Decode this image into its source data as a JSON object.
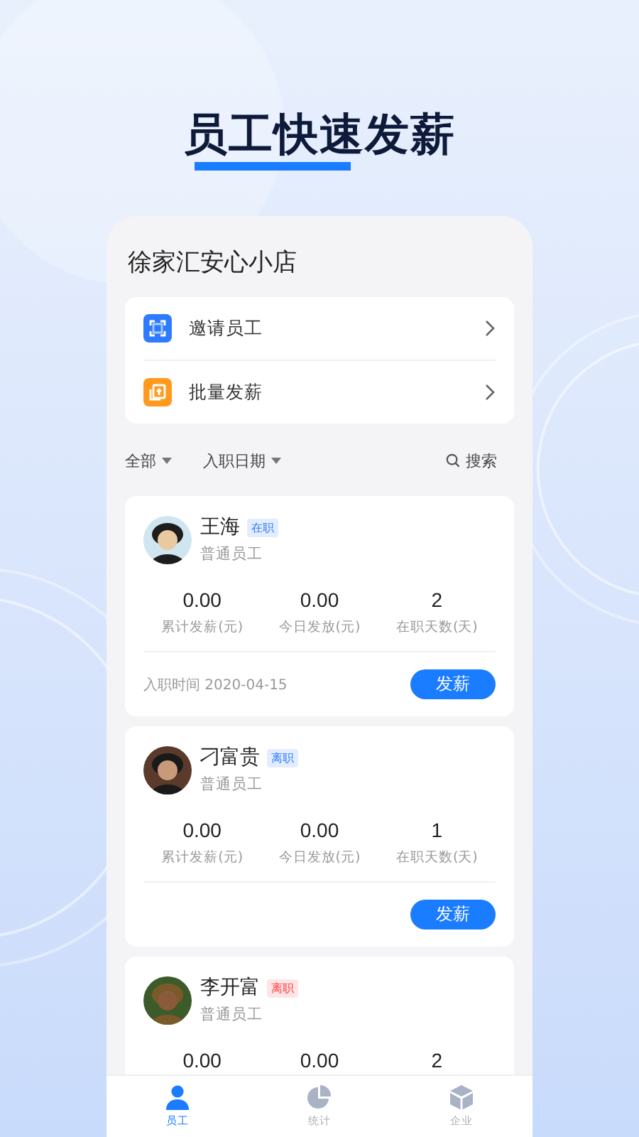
{
  "headline": "员工快速发薪",
  "store": {
    "name": "徐家汇安心小店"
  },
  "actions": [
    {
      "kind": "invite",
      "label": "邀请员工",
      "color": "#2f7bff"
    },
    {
      "kind": "batch",
      "label": "批量发薪",
      "color": "#ff9a1f"
    }
  ],
  "filters": [
    {
      "label": "全部"
    },
    {
      "label": "入职日期"
    }
  ],
  "search": {
    "label": "搜索"
  },
  "employees": [
    {
      "name": "王海",
      "status": "在职",
      "color": "#2f7bff",
      "role": "普通员工",
      "stats": [
        {
          "value": "0.00",
          "label": "累计发薪(元)"
        },
        {
          "value": "0.00",
          "label": "今日发放(元)"
        },
        {
          "value": "2",
          "label": "在职天数(天)"
        }
      ],
      "hire_date": "入职时间 2020-04-15",
      "button": "发薪"
    },
    {
      "name": "刁富贵",
      "status": "离职",
      "color": "#2f7bff",
      "role": "普通员工",
      "stats": [
        {
          "value": "0.00",
          "label": "累计发薪(元)"
        },
        {
          "value": "0.00",
          "label": "今日发放(元)"
        },
        {
          "value": "1",
          "label": "在职天数(天)"
        }
      ],
      "button": "发薪"
    },
    {
      "name": "李开富",
      "status": "离职",
      "color": "#ff3b3b",
      "role": "普通员工",
      "stats": [
        {
          "value": "0.00"
        },
        {
          "value": "0.00"
        },
        {
          "value": "2"
        }
      ]
    }
  ],
  "tabs": [
    {
      "kind": "person",
      "label": "员工",
      "selected": true
    },
    {
      "kind": "pie",
      "label": "统计",
      "selected": false
    },
    {
      "kind": "cube",
      "label": "企业",
      "selected": false
    }
  ]
}
